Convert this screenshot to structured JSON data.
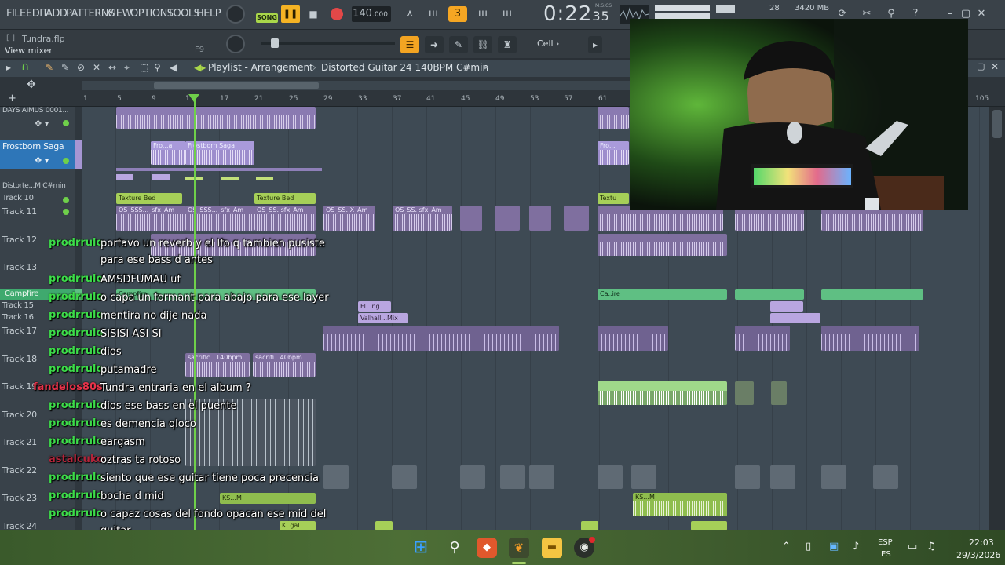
{
  "menubar": {
    "items": [
      "FILE",
      "EDIT",
      "ADD",
      "PATTERNS",
      "VIEW",
      "OPTIONS",
      "TOOLS",
      "HELP"
    ],
    "song_label": "SONG",
    "tempo": "140",
    "tempo_decimal": ".000",
    "time_main": "0:22",
    "time_sub": "35",
    "time_unit": "M:S:CS",
    "cpu": "28",
    "memory": "3420 MB"
  },
  "row2": {
    "file_name": "Tundra.flp",
    "hint": "View mixer",
    "hint_key": "F9",
    "snap": "Cell"
  },
  "playlist": {
    "title": "Playlist - Arrangement",
    "separator": "›",
    "pattern": "Distorted Guitar 24 140BPM C#min",
    "arrow": "▸"
  },
  "ruler": {
    "bars": [
      "1",
      "5",
      "9",
      "13",
      "17",
      "21",
      "25",
      "29",
      "33",
      "37",
      "41",
      "45",
      "49",
      "53",
      "57",
      "61",
      "105"
    ]
  },
  "tracks": [
    {
      "label": "DAYS AIMUS 0001..."
    },
    {
      "label": "Frostborn Saga"
    },
    {
      "label": "Distorte...M C#min"
    },
    {
      "label": "Track 10"
    },
    {
      "label": "Track 11"
    },
    {
      "label": "Track 12"
    },
    {
      "label": "Track 13"
    },
    {
      "label": "Campfire"
    },
    {
      "label": "Track 15"
    },
    {
      "label": "Track 16"
    },
    {
      "label": "Track 17"
    },
    {
      "label": "Track 18"
    },
    {
      "label": "Track 19"
    },
    {
      "label": "Track 20"
    },
    {
      "label": "Track 21"
    },
    {
      "label": "Track 22"
    },
    {
      "label": "Track 23"
    },
    {
      "label": "Track 24"
    }
  ],
  "clips": {
    "frostborn_a": "Fro...a",
    "frostborn_b": "Frostborn Saga",
    "frostborn_c": "Fro...",
    "texture_a": "Texture Bed",
    "texture_b": "Texture Bed",
    "texture_c": "Textu",
    "sfx_a": "OS_SSS..._sfx_Am",
    "sfx_b": "OS_SSS..._sfx_Am",
    "sfx_c": "OS_SS..sfx_Am",
    "sfx_d": "OS_SS..X_Am",
    "sfx_e": "OS_SS..sfx_Am",
    "campfire_a": "Campfire",
    "campfire_b": "Ca..ire",
    "fling": "Fl...ng",
    "valhall": "Valhall...Mix",
    "sacrific_a": "sacrific...140bpm",
    "sacrific_b": "sacrifi...40bpm",
    "ks_a": "KS...M",
    "ks_b": "KS...M",
    "kgal": "K..gal"
  },
  "chat": [
    {
      "user": "prodrrulo",
      "color": "#3ddc4a",
      "message": "porfavo un reverb y el lfo q tambien pusiste para ese bass d antes"
    },
    {
      "user": "prodrrulo",
      "color": "#3ddc4a",
      "message": "AMSDFUMAU uf"
    },
    {
      "user": "prodrrulo",
      "color": "#3ddc4a",
      "message": "o capa un formant para abajo para ese layer"
    },
    {
      "user": "prodrrulo",
      "color": "#3ddc4a",
      "message": "mentira no dije nada"
    },
    {
      "user": "prodrrulo",
      "color": "#3ddc4a",
      "message": "SISISI ASI SI"
    },
    {
      "user": "prodrrulo",
      "color": "#3ddc4a",
      "message": "dios"
    },
    {
      "user": "prodrrulo",
      "color": "#3ddc4a",
      "message": "putamadre"
    },
    {
      "user": "fandelos80s",
      "color": "#e8334a",
      "message": "Tundra entraria en el album ?"
    },
    {
      "user": "prodrrulo",
      "color": "#3ddc4a",
      "message": "dios ese bass en el puente"
    },
    {
      "user": "prodrrulo",
      "color": "#3ddc4a",
      "message": "es demencia qloco"
    },
    {
      "user": "prodrrulo",
      "color": "#3ddc4a",
      "message": "eargasm"
    },
    {
      "user": "astalcuko",
      "color": "#b3243a",
      "message": "oztras ta rotoso"
    },
    {
      "user": "prodrrulo",
      "color": "#3ddc4a",
      "message": "siento que ese guitar tiene poca precencia"
    },
    {
      "user": "prodrrulo",
      "color": "#3ddc4a",
      "message": "bocha d mid"
    },
    {
      "user": "prodrrulo",
      "color": "#3ddc4a",
      "message": "o capaz cosas del fondo opacan ese mid del guitar"
    }
  ],
  "taskbar": {
    "lang_top": "ESP",
    "lang_bottom": "ES",
    "time": "22:03",
    "date": "29/3/2026"
  },
  "colors": {
    "accent_green": "#a9d74a",
    "play_orange": "#f5b324",
    "record_red": "#e34848",
    "clip_purple": "#b5a3d8",
    "clip_green": "#8fcf6a",
    "clip_teal": "#6bbf8f"
  }
}
